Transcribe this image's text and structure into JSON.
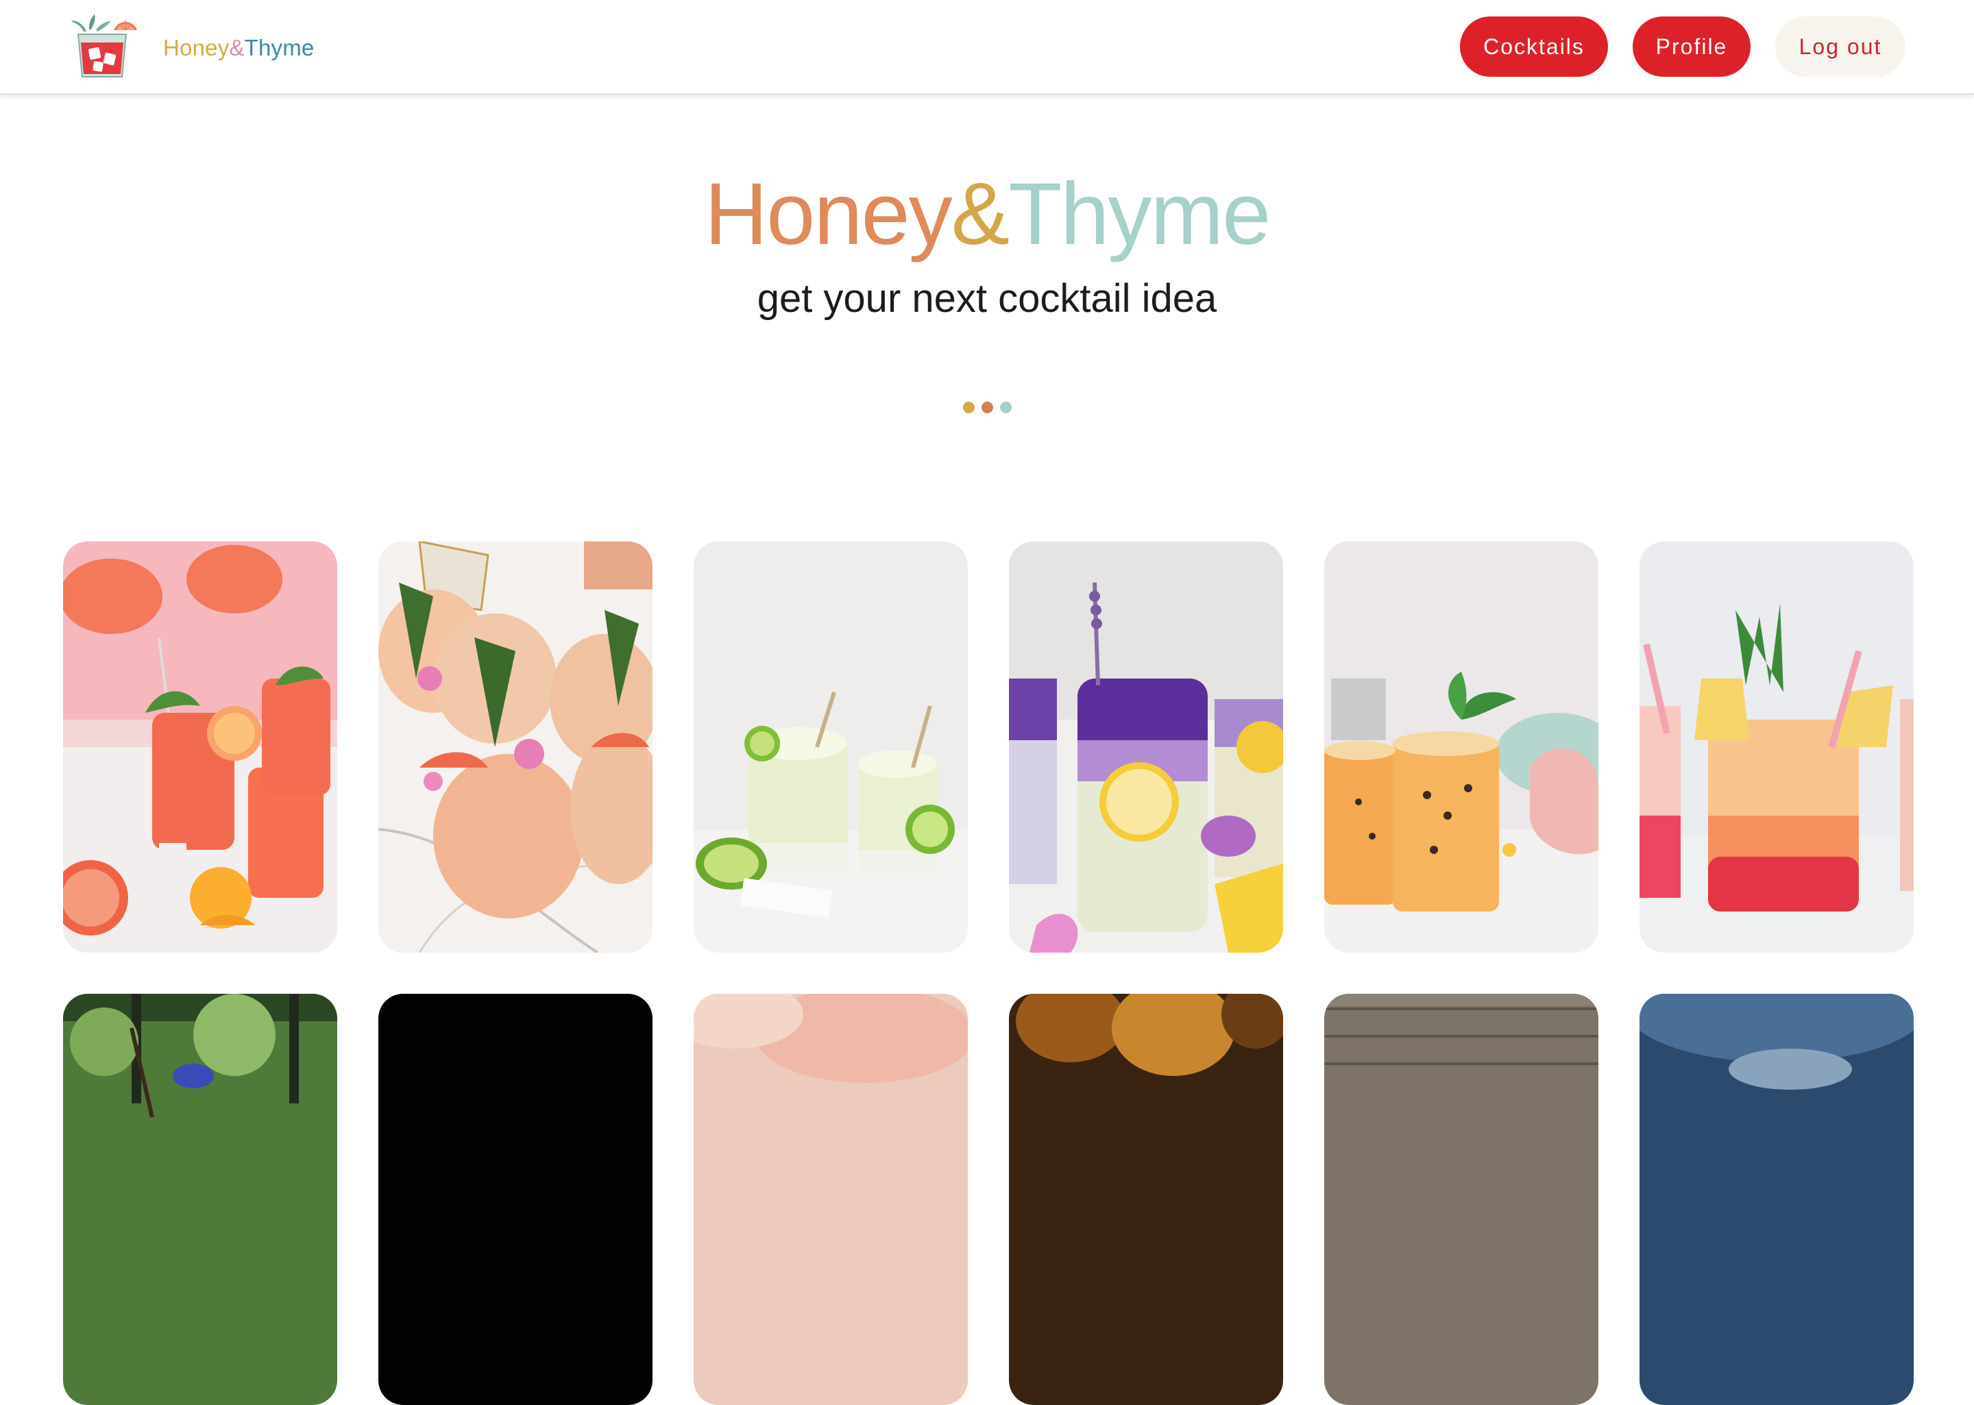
{
  "navbar": {
    "brand": {
      "honey": "Honey",
      "amp": "&",
      "thyme": "Thyme",
      "logo_icon": "cocktail-glass-logo-icon"
    },
    "buttons": {
      "cocktails": "Cocktails",
      "profile": "Profile",
      "logout": "Log out"
    }
  },
  "hero": {
    "title": {
      "honey": "Honey",
      "amp": "&",
      "thyme": "Thyme"
    },
    "subtitle": "get your next cocktail idea",
    "dot_colors": [
      "#d6a84c",
      "#d97c52",
      "#a6d0ca"
    ]
  },
  "colors": {
    "accent_red": "#dc2228",
    "logout_bg": "#f7f4ee",
    "brand_honey": "#d8a83c",
    "brand_thyme": "#3b88a6",
    "hero_honey": "#de8a5b",
    "hero_amp": "#d3a746",
    "hero_thyme": "#a6d0ca"
  },
  "cocktail_cards": [
    {
      "name": "grapefruit-slush-card"
    },
    {
      "name": "grapefruit-pineapple-crush-card"
    },
    {
      "name": "lime-frozen-cocktail-card"
    },
    {
      "name": "lavender-lemonade-card"
    },
    {
      "name": "passion-fruit-cocktail-card"
    },
    {
      "name": "pineapple-sunrise-card"
    },
    {
      "name": "garden-cocktail-card"
    },
    {
      "name": "dark-cocktail-card"
    },
    {
      "name": "pink-cocktail-card"
    },
    {
      "name": "amber-cocktail-card"
    },
    {
      "name": "rustic-wood-cocktail-card"
    },
    {
      "name": "blue-cocktail-card"
    }
  ]
}
